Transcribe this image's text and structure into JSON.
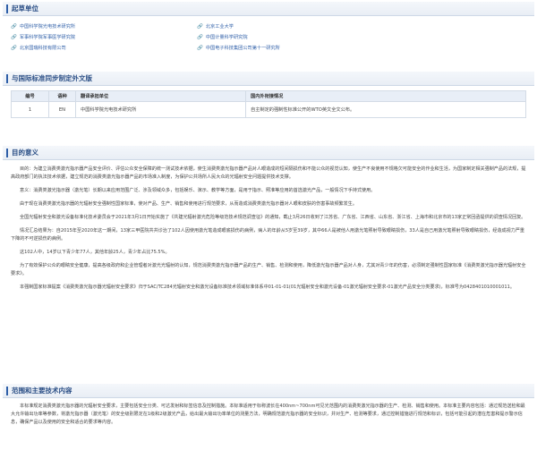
{
  "drafting": {
    "title": "起草单位",
    "units": [
      "中国科学院光电技术研究所",
      "北京工业大学",
      "军事科学院军事医学研究院",
      "中国计量科学研究院",
      "北京国瑞科技有限公司",
      "中国电子科技集团公司第十一研究所"
    ]
  },
  "intl": {
    "title": "与国际标准同步制定外文版",
    "headers": [
      "编号",
      "语种",
      "翻译承担单位",
      "国内外衔接情况"
    ],
    "rows": [
      [
        "1",
        "EN",
        "中国科学院光电技术研究所",
        "自主制定的强制性标准公开的WTO英文全文公布。"
      ]
    ]
  },
  "purpose": {
    "title": "目的意义",
    "paragraphs": [
      "目的：为建立消费类激光指示器产品安全评价、评估公众安全保障的统一测试技术依据，使生消费类激光指示器产品对人眼造成的短间隔损伤和不能公众的视觉认知，使生产不良使用不规格欠可能安全的作业和生活，为国家制定相关强制产品的法规，提高政府部门的执法技术依据，建立规范的消费类激光指示器产品的市场准入制度，为保护公共场所人民大众的光辐射安全问题提供技术支撑。",
      "意义：消费类激光指示器（激光笔）长期以来应用范围广泛、涉及领域众多，包括娱乐、演示、教学等方面，是用于指示、照准等应用的首选激光产品，一般情况下手持式使用。",
      "由于现在消费类激光指示器的光辐射安全强制性国家标准，使对产品、生产、销售和使用进行规范要求，从而造成消费类激光指示器对人眼和皮肤的伤害事故频繁发生。",
      "全国光辐射安全和激光设备标准化技术委员会于2021年3月1日开始实施了《共建光辐射激光危险等级范技术规范调查征》的通知，截止3月26日收到了江苏省、广东省、江西省、山东省、浙江省、上海市和北京市的13家正常回函提供的调查情况回复。",
      "情况汇总结果为：自2015年至2020年这一期间，13家三甲医院共共诊治了102人因使用激光笔造成眼底损伤的病例，病人的年龄从5岁至39岁，其中66人是被他人用激光笔照射导致眼睛损伤，33人是自己用激光笔照射导致眼睛损伤，经造成视力严重下降的不可逆损伤的病例。",
      "这102人中，14岁以下青少年77人，其他年龄25人，青少年占比75.5%。",
      "为了有效保护公众的眼睛安全健康，提高各级政府和企业管理者对激光光辐射的认知，规范消费类激光指示器产品的生产、销售、检测和使用，降低激光指示器产品对人身，尤其对青少年的伤害，必须制定强制性国家标准《消费类激光指示器光辐射安全要求》。",
      "本强制国家标准提案《消费类激光指示器光辐射安全要求》归于SAC/TC284光辐射安全和激光设备标准技术领域标准体系中01-01-01(01光辐射安全和激光设备-01激光辐射安全要求-01激光产品安全分类要求)，标准号为0428401010001011。"
    ]
  },
  "scope": {
    "title": "范围和主要技术内容",
    "paragraphs": [
      "本标准规定消费类激光指示器的光辐射安全要求，主要包括安全分类、可达发射和标签信息及控制措施。本标准适用于标称波长在400nm~700nm可见光范围内的消费类激光指示器的生产、检测、销售和使用。本标准主要内容包括：通过规范送检和最大允许输出功率等参数，将激光指示器（激光笔）的安全级别限定在1级和2级激光产品，给出最大输出功率单位的测量方法，明确规范激光指示器的安全标识，并对生产、检测等要求，通过控制措施进行规范和标识，包括可能引起的潜在危害和提示警示信息，确保产品以及使用的安全和适合的要求等内容。"
    ]
  }
}
